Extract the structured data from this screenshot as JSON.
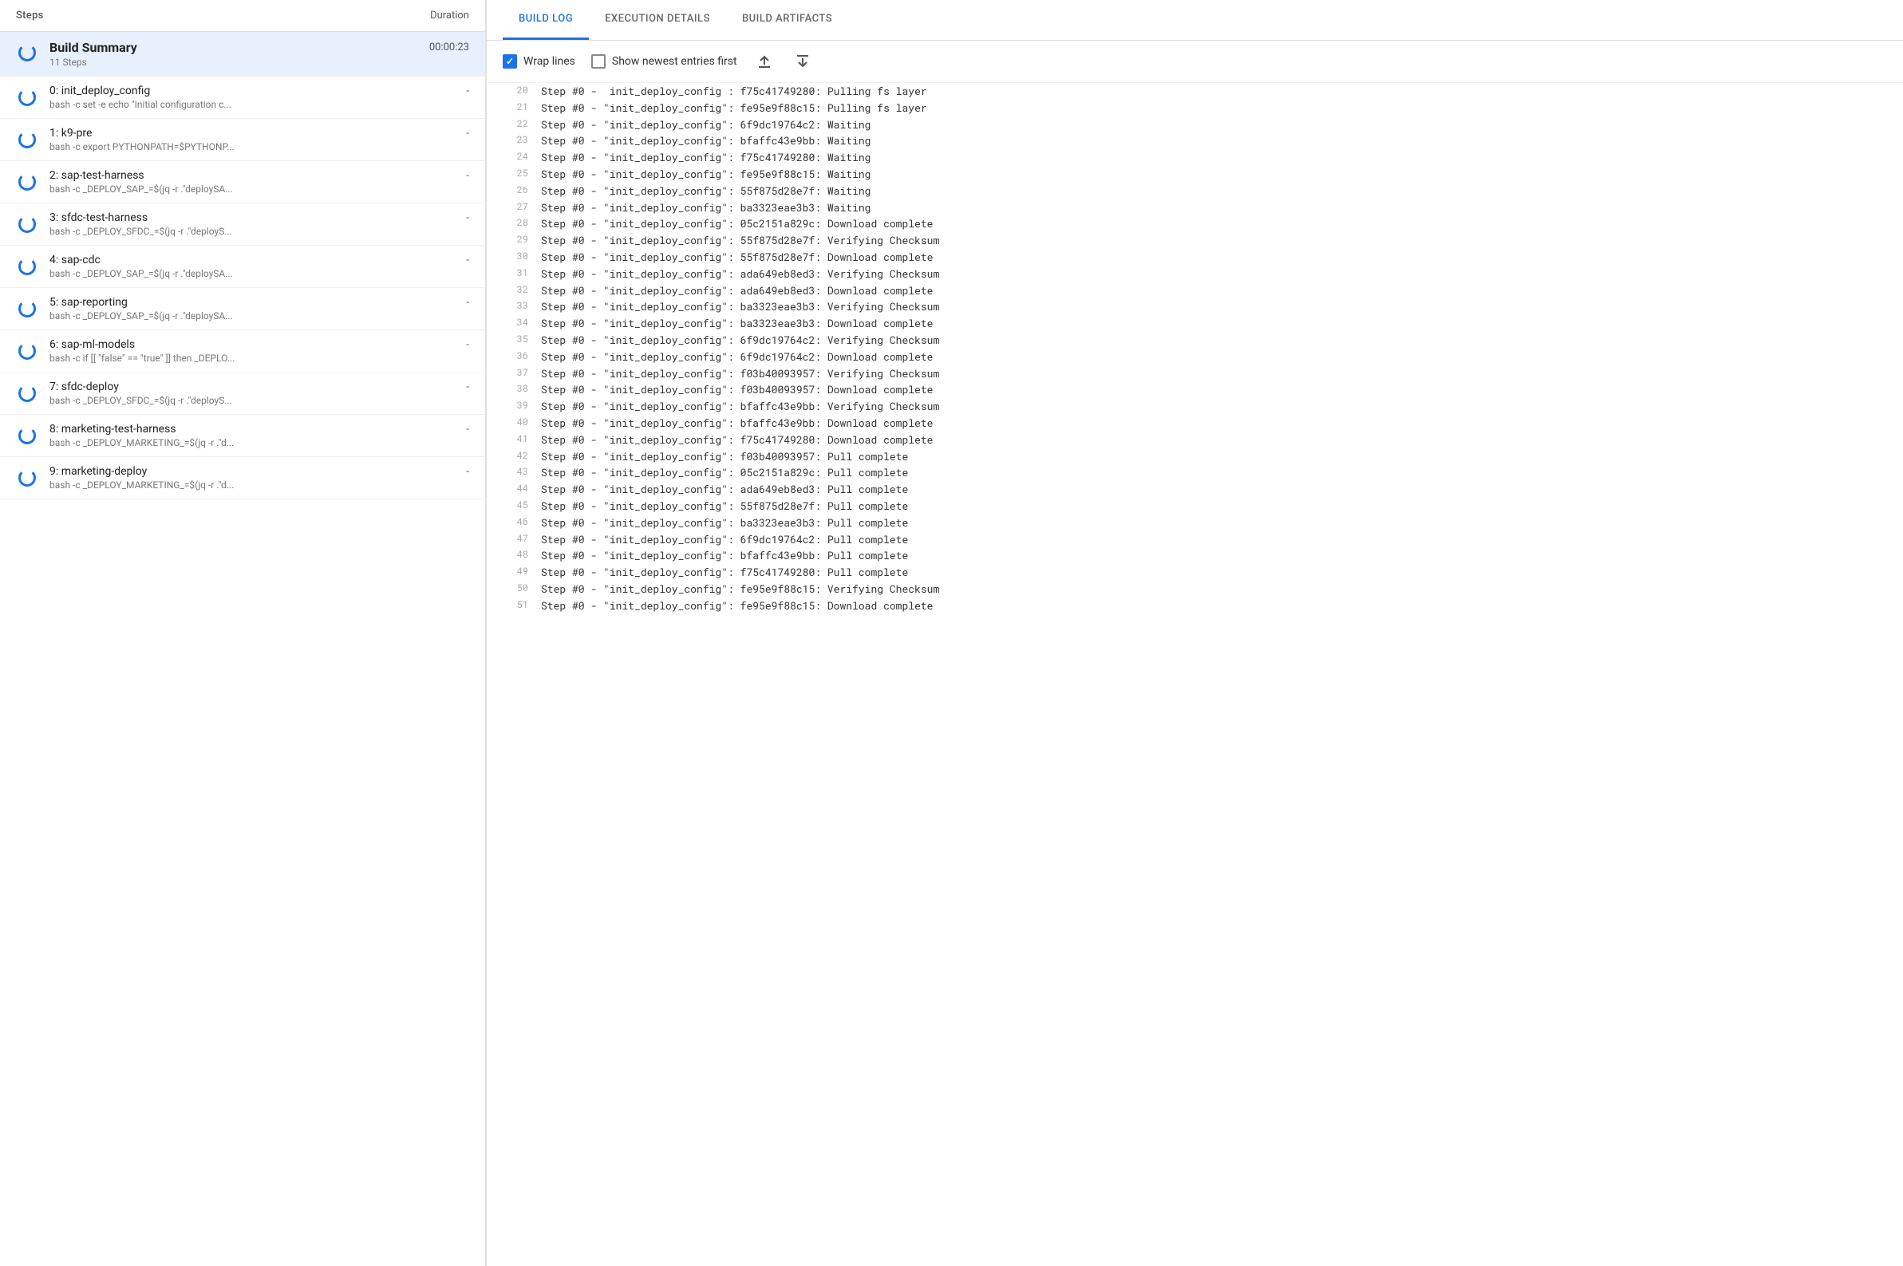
{
  "leftPanel": {
    "header": {
      "stepsLabel": "Steps",
      "durationLabel": "Duration"
    },
    "buildSummary": {
      "name": "Build Summary",
      "duration": "00:00:23",
      "substeps": "11 Steps"
    },
    "steps": [
      {
        "id": 0,
        "name": "0: init_deploy_config",
        "command": "bash -c set -e echo \"Initial configuration c...",
        "duration": "-"
      },
      {
        "id": 1,
        "name": "1: k9-pre",
        "command": "bash -c export PYTHONPATH=$PYTHONP...",
        "duration": "-"
      },
      {
        "id": 2,
        "name": "2: sap-test-harness",
        "command": "bash -c _DEPLOY_SAP_=$(jq -r .\"deploySA...",
        "duration": "-"
      },
      {
        "id": 3,
        "name": "3: sfdc-test-harness",
        "command": "bash -c _DEPLOY_SFDC_=$(jq -r .\"deployS...",
        "duration": "-"
      },
      {
        "id": 4,
        "name": "4: sap-cdc",
        "command": "bash -c _DEPLOY_SAP_=$(jq -r .\"deploySA...",
        "duration": "-"
      },
      {
        "id": 5,
        "name": "5: sap-reporting",
        "command": "bash -c _DEPLOY_SAP_=$(jq -r .\"deploySA...",
        "duration": "-"
      },
      {
        "id": 6,
        "name": "6: sap-ml-models",
        "command": "bash -c if [[ \"false\" == \"true\" ]] then _DEPLO...",
        "duration": "-"
      },
      {
        "id": 7,
        "name": "7: sfdc-deploy",
        "command": "bash -c _DEPLOY_SFDC_=$(jq -r .\"deployS...",
        "duration": "-"
      },
      {
        "id": 8,
        "name": "8: marketing-test-harness",
        "command": "bash -c _DEPLOY_MARKETING_=$(jq -r .\"d...",
        "duration": "-"
      },
      {
        "id": 9,
        "name": "9: marketing-deploy",
        "command": "bash -c _DEPLOY_MARKETING_=$(jq -r .\"d...",
        "duration": "-"
      }
    ]
  },
  "rightPanel": {
    "tabs": [
      {
        "label": "BUILD LOG",
        "active": true
      },
      {
        "label": "EXECUTION DETAILS",
        "active": false
      },
      {
        "label": "BUILD ARTIFACTS",
        "active": false
      }
    ],
    "toolbar": {
      "wrapLinesLabel": "Wrap lines",
      "wrapLinesChecked": true,
      "showNewestLabel": "Show newest entries first",
      "showNewestChecked": false
    },
    "logLines": [
      {
        "num": 20,
        "text": "Step #0 -  init_deploy_config : f75c41749280: Pulling fs layer"
      },
      {
        "num": 21,
        "text": "Step #0 - \"init_deploy_config\": fe95e9f88c15: Pulling fs layer"
      },
      {
        "num": 22,
        "text": "Step #0 - \"init_deploy_config\": 6f9dc19764c2: Waiting"
      },
      {
        "num": 23,
        "text": "Step #0 - \"init_deploy_config\": bfaffc43e9bb: Waiting"
      },
      {
        "num": 24,
        "text": "Step #0 - \"init_deploy_config\": f75c41749280: Waiting"
      },
      {
        "num": 25,
        "text": "Step #0 - \"init_deploy_config\": fe95e9f88c15: Waiting"
      },
      {
        "num": 26,
        "text": "Step #0 - \"init_deploy_config\": 55f875d28e7f: Waiting"
      },
      {
        "num": 27,
        "text": "Step #0 - \"init_deploy_config\": ba3323eae3b3: Waiting"
      },
      {
        "num": 28,
        "text": "Step #0 - \"init_deploy_config\": 05c2151a829c: Download complete"
      },
      {
        "num": 29,
        "text": "Step #0 - \"init_deploy_config\": 55f875d28e7f: Verifying Checksum"
      },
      {
        "num": 30,
        "text": "Step #0 - \"init_deploy_config\": 55f875d28e7f: Download complete"
      },
      {
        "num": 31,
        "text": "Step #0 - \"init_deploy_config\": ada649eb8ed3: Verifying Checksum"
      },
      {
        "num": 32,
        "text": "Step #0 - \"init_deploy_config\": ada649eb8ed3: Download complete"
      },
      {
        "num": 33,
        "text": "Step #0 - \"init_deploy_config\": ba3323eae3b3: Verifying Checksum"
      },
      {
        "num": 34,
        "text": "Step #0 - \"init_deploy_config\": ba3323eae3b3: Download complete"
      },
      {
        "num": 35,
        "text": "Step #0 - \"init_deploy_config\": 6f9dc19764c2: Verifying Checksum"
      },
      {
        "num": 36,
        "text": "Step #0 - \"init_deploy_config\": 6f9dc19764c2: Download complete"
      },
      {
        "num": 37,
        "text": "Step #0 - \"init_deploy_config\": f03b40093957: Verifying Checksum"
      },
      {
        "num": 38,
        "text": "Step #0 - \"init_deploy_config\": f03b40093957: Download complete"
      },
      {
        "num": 39,
        "text": "Step #0 - \"init_deploy_config\": bfaffc43e9bb: Verifying Checksum"
      },
      {
        "num": 40,
        "text": "Step #0 - \"init_deploy_config\": bfaffc43e9bb: Download complete"
      },
      {
        "num": 41,
        "text": "Step #0 - \"init_deploy_config\": f75c41749280: Download complete"
      },
      {
        "num": 42,
        "text": "Step #0 - \"init_deploy_config\": f03b40093957: Pull complete"
      },
      {
        "num": 43,
        "text": "Step #0 - \"init_deploy_config\": 05c2151a829c: Pull complete"
      },
      {
        "num": 44,
        "text": "Step #0 - \"init_deploy_config\": ada649eb8ed3: Pull complete"
      },
      {
        "num": 45,
        "text": "Step #0 - \"init_deploy_config\": 55f875d28e7f: Pull complete"
      },
      {
        "num": 46,
        "text": "Step #0 - \"init_deploy_config\": ba3323eae3b3: Pull complete"
      },
      {
        "num": 47,
        "text": "Step #0 - \"init_deploy_config\": 6f9dc19764c2: Pull complete"
      },
      {
        "num": 48,
        "text": "Step #0 - \"init_deploy_config\": bfaffc43e9bb: Pull complete"
      },
      {
        "num": 49,
        "text": "Step #0 - \"init_deploy_config\": f75c41749280: Pull complete"
      },
      {
        "num": 50,
        "text": "Step #0 - \"init_deploy_config\": fe95e9f88c15: Verifying Checksum"
      },
      {
        "num": 51,
        "text": "Step #0 - \"init_deploy_config\": fe95e9f88c15: Download complete"
      }
    ]
  }
}
